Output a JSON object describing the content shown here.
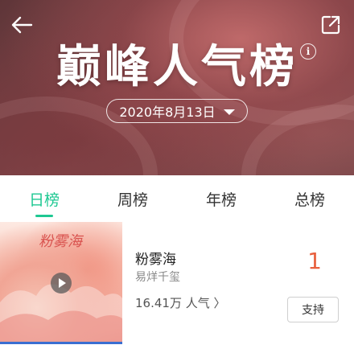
{
  "header": {
    "title": "巅峰人气榜",
    "date": "2020年8月13日",
    "info_symbol": "i"
  },
  "tabs": [
    {
      "label": "日榜",
      "active": true
    },
    {
      "label": "周榜",
      "active": false
    },
    {
      "label": "年榜",
      "active": false
    },
    {
      "label": "总榜",
      "active": false
    }
  ],
  "song": {
    "title": "粉雾海",
    "artist": "易烊千玺",
    "popularity": "16.41万 人气 〉",
    "rank": "1",
    "support_label": "支持",
    "cover_text": "粉雾海"
  },
  "colors": {
    "accent": "#1ec892",
    "rank": "#e8603e"
  }
}
